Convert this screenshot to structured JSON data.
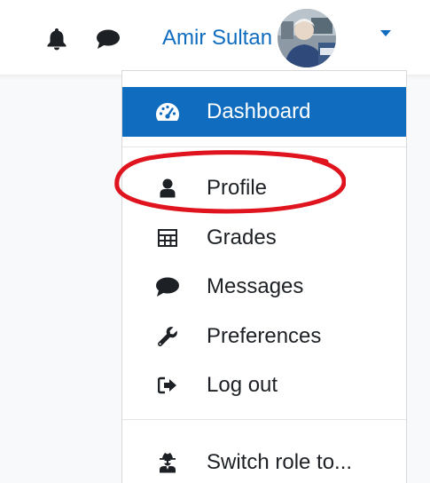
{
  "user": {
    "name": "Amir Sultan"
  },
  "icons": {
    "notifications": "bell-icon",
    "messages": "chat-bubble-icon",
    "caret": "caret-down-icon"
  },
  "colors": {
    "link_blue": "#0f6cbf",
    "active_bg": "#0f6cbf",
    "annotation_red": "#e0141e",
    "text_dark": "#1d2125"
  },
  "menu": {
    "items": [
      {
        "label": "Dashboard",
        "icon": "dashboard-gauge-icon",
        "active": true
      },
      {
        "label": "Profile",
        "icon": "user-icon",
        "active": false
      },
      {
        "label": "Grades",
        "icon": "table-grid-icon",
        "active": false
      },
      {
        "label": "Messages",
        "icon": "chat-bubble-icon",
        "active": false
      },
      {
        "label": "Preferences",
        "icon": "wrench-icon",
        "active": false
      },
      {
        "label": "Log out",
        "icon": "sign-out-icon",
        "active": false
      },
      {
        "label": "Switch role to...",
        "icon": "user-secret-icon",
        "active": false
      }
    ]
  }
}
